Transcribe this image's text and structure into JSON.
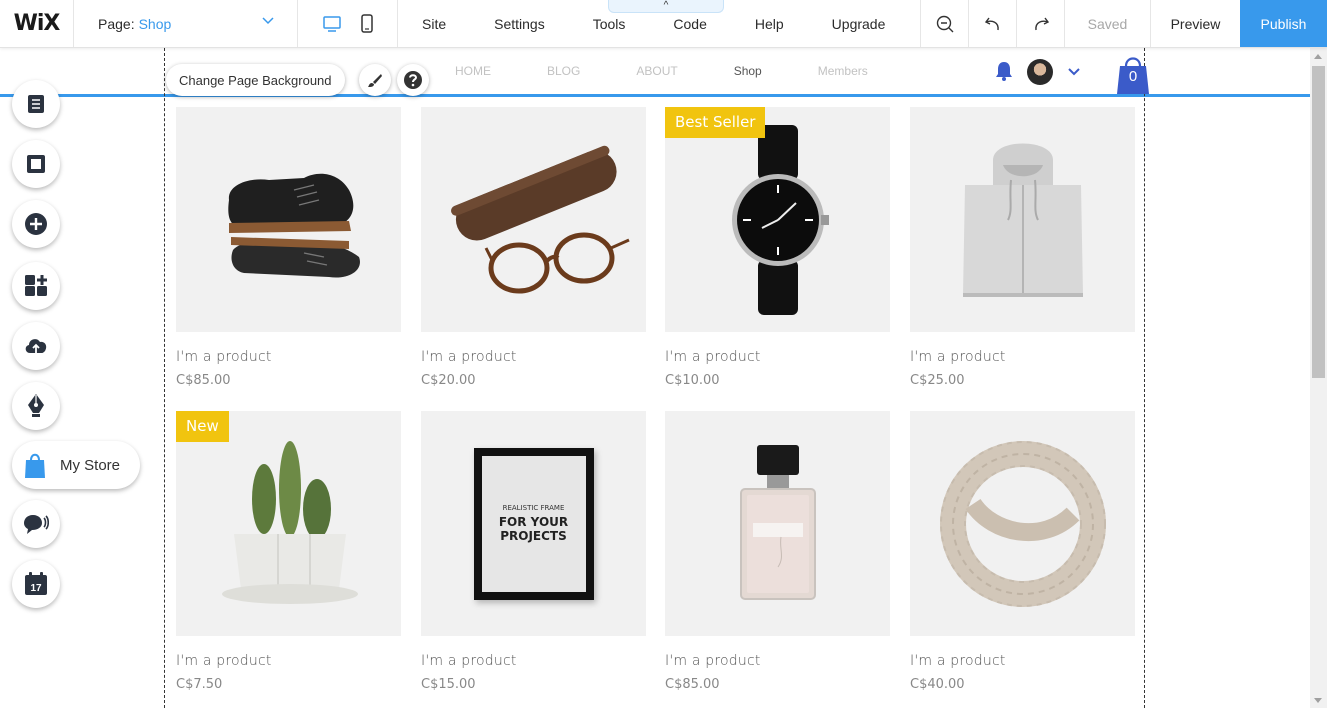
{
  "topbar": {
    "logo": "WiX",
    "page_label": "Page:",
    "page_name": "Shop",
    "menu": [
      "Site",
      "Settings",
      "Tools",
      "Code",
      "Help",
      "Upgrade"
    ],
    "saved": "Saved",
    "preview": "Preview",
    "publish": "Publish",
    "code_tab_arrow": "^"
  },
  "colors": {
    "accent": "#3899ec",
    "ribbon": "#f1c40f",
    "cart": "#3b5bc9"
  },
  "site": {
    "nav": [
      "HOME",
      "BLOG",
      "ABOUT",
      "Shop",
      "Members"
    ],
    "active_nav": "Shop",
    "cart_count": "0"
  },
  "editor": {
    "change_bg": "Change Page Background"
  },
  "left_toolbar": {
    "icons": [
      "pages-icon",
      "background-icon",
      "add-icon",
      "apps-icon",
      "upload-icon",
      "blog-pen-icon",
      "store-bag-icon",
      "chat-icon",
      "calendar-icon"
    ],
    "my_store": "My Store",
    "calendar_day": "17"
  },
  "products": [
    {
      "name": "I'm a product",
      "price": "C$85.00",
      "ribbon": "",
      "image": "shoes"
    },
    {
      "name": "I'm a product",
      "price": "C$20.00",
      "ribbon": "",
      "image": "glasses"
    },
    {
      "name": "I'm a product",
      "price": "C$10.00",
      "ribbon": "Best Seller",
      "image": "watch"
    },
    {
      "name": "I'm a product",
      "price": "C$25.00",
      "ribbon": "",
      "image": "hoodie"
    },
    {
      "name": "I'm a product",
      "price": "C$7.50",
      "ribbon": "New",
      "image": "cactus"
    },
    {
      "name": "I'm a product",
      "price": "C$15.00",
      "ribbon": "",
      "image": "frame"
    },
    {
      "name": "I'm a product",
      "price": "C$85.00",
      "ribbon": "",
      "image": "perfume"
    },
    {
      "name": "I'm a product",
      "price": "C$40.00",
      "ribbon": "",
      "image": "scarf"
    }
  ],
  "frame_text": [
    "REALISTIC FRAME",
    "FOR YOUR",
    "PROJECTS"
  ]
}
